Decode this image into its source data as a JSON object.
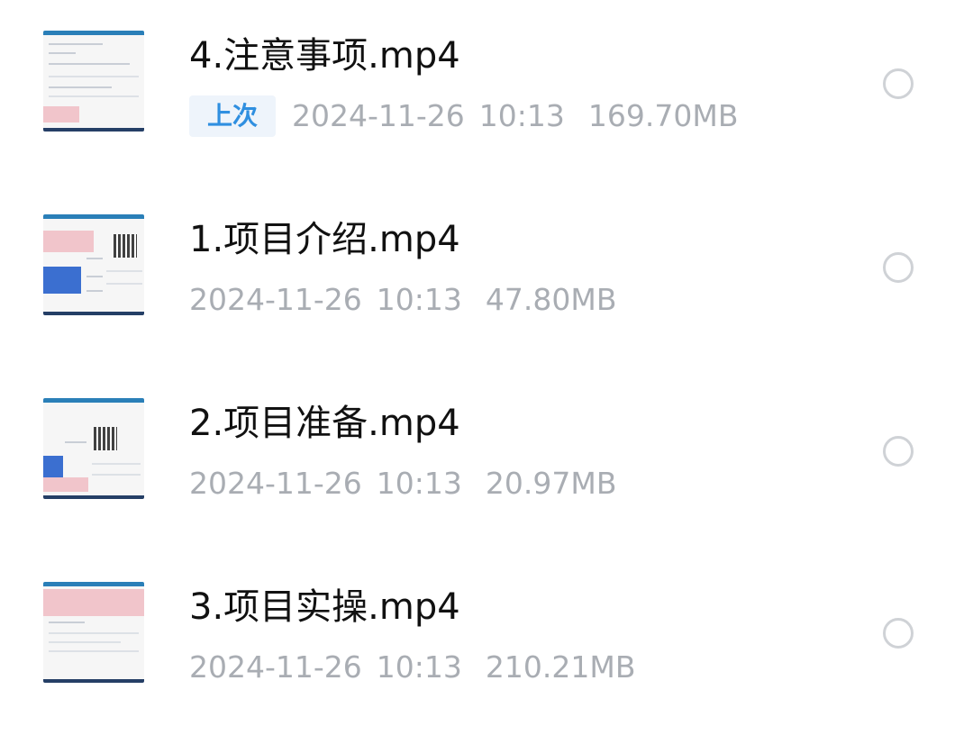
{
  "files": [
    {
      "name": "4.注意事项.mp4",
      "badge": "上次",
      "date": "2024-11-26",
      "time": "10:13",
      "size": "169.70MB"
    },
    {
      "name": "1.项目介绍.mp4",
      "date": "2024-11-26",
      "time": "10:13",
      "size": "47.80MB"
    },
    {
      "name": "2.项目准备.mp4",
      "date": "2024-11-26",
      "time": "10:13",
      "size": "20.97MB"
    },
    {
      "name": "3.项目实操.mp4",
      "date": "2024-11-26",
      "time": "10:13",
      "size": "210.21MB"
    }
  ],
  "colors": {
    "badge_text": "#2f8fe0",
    "badge_bg": "#eef4fb",
    "meta_text": "#a9adb3",
    "name_text": "#111111"
  }
}
